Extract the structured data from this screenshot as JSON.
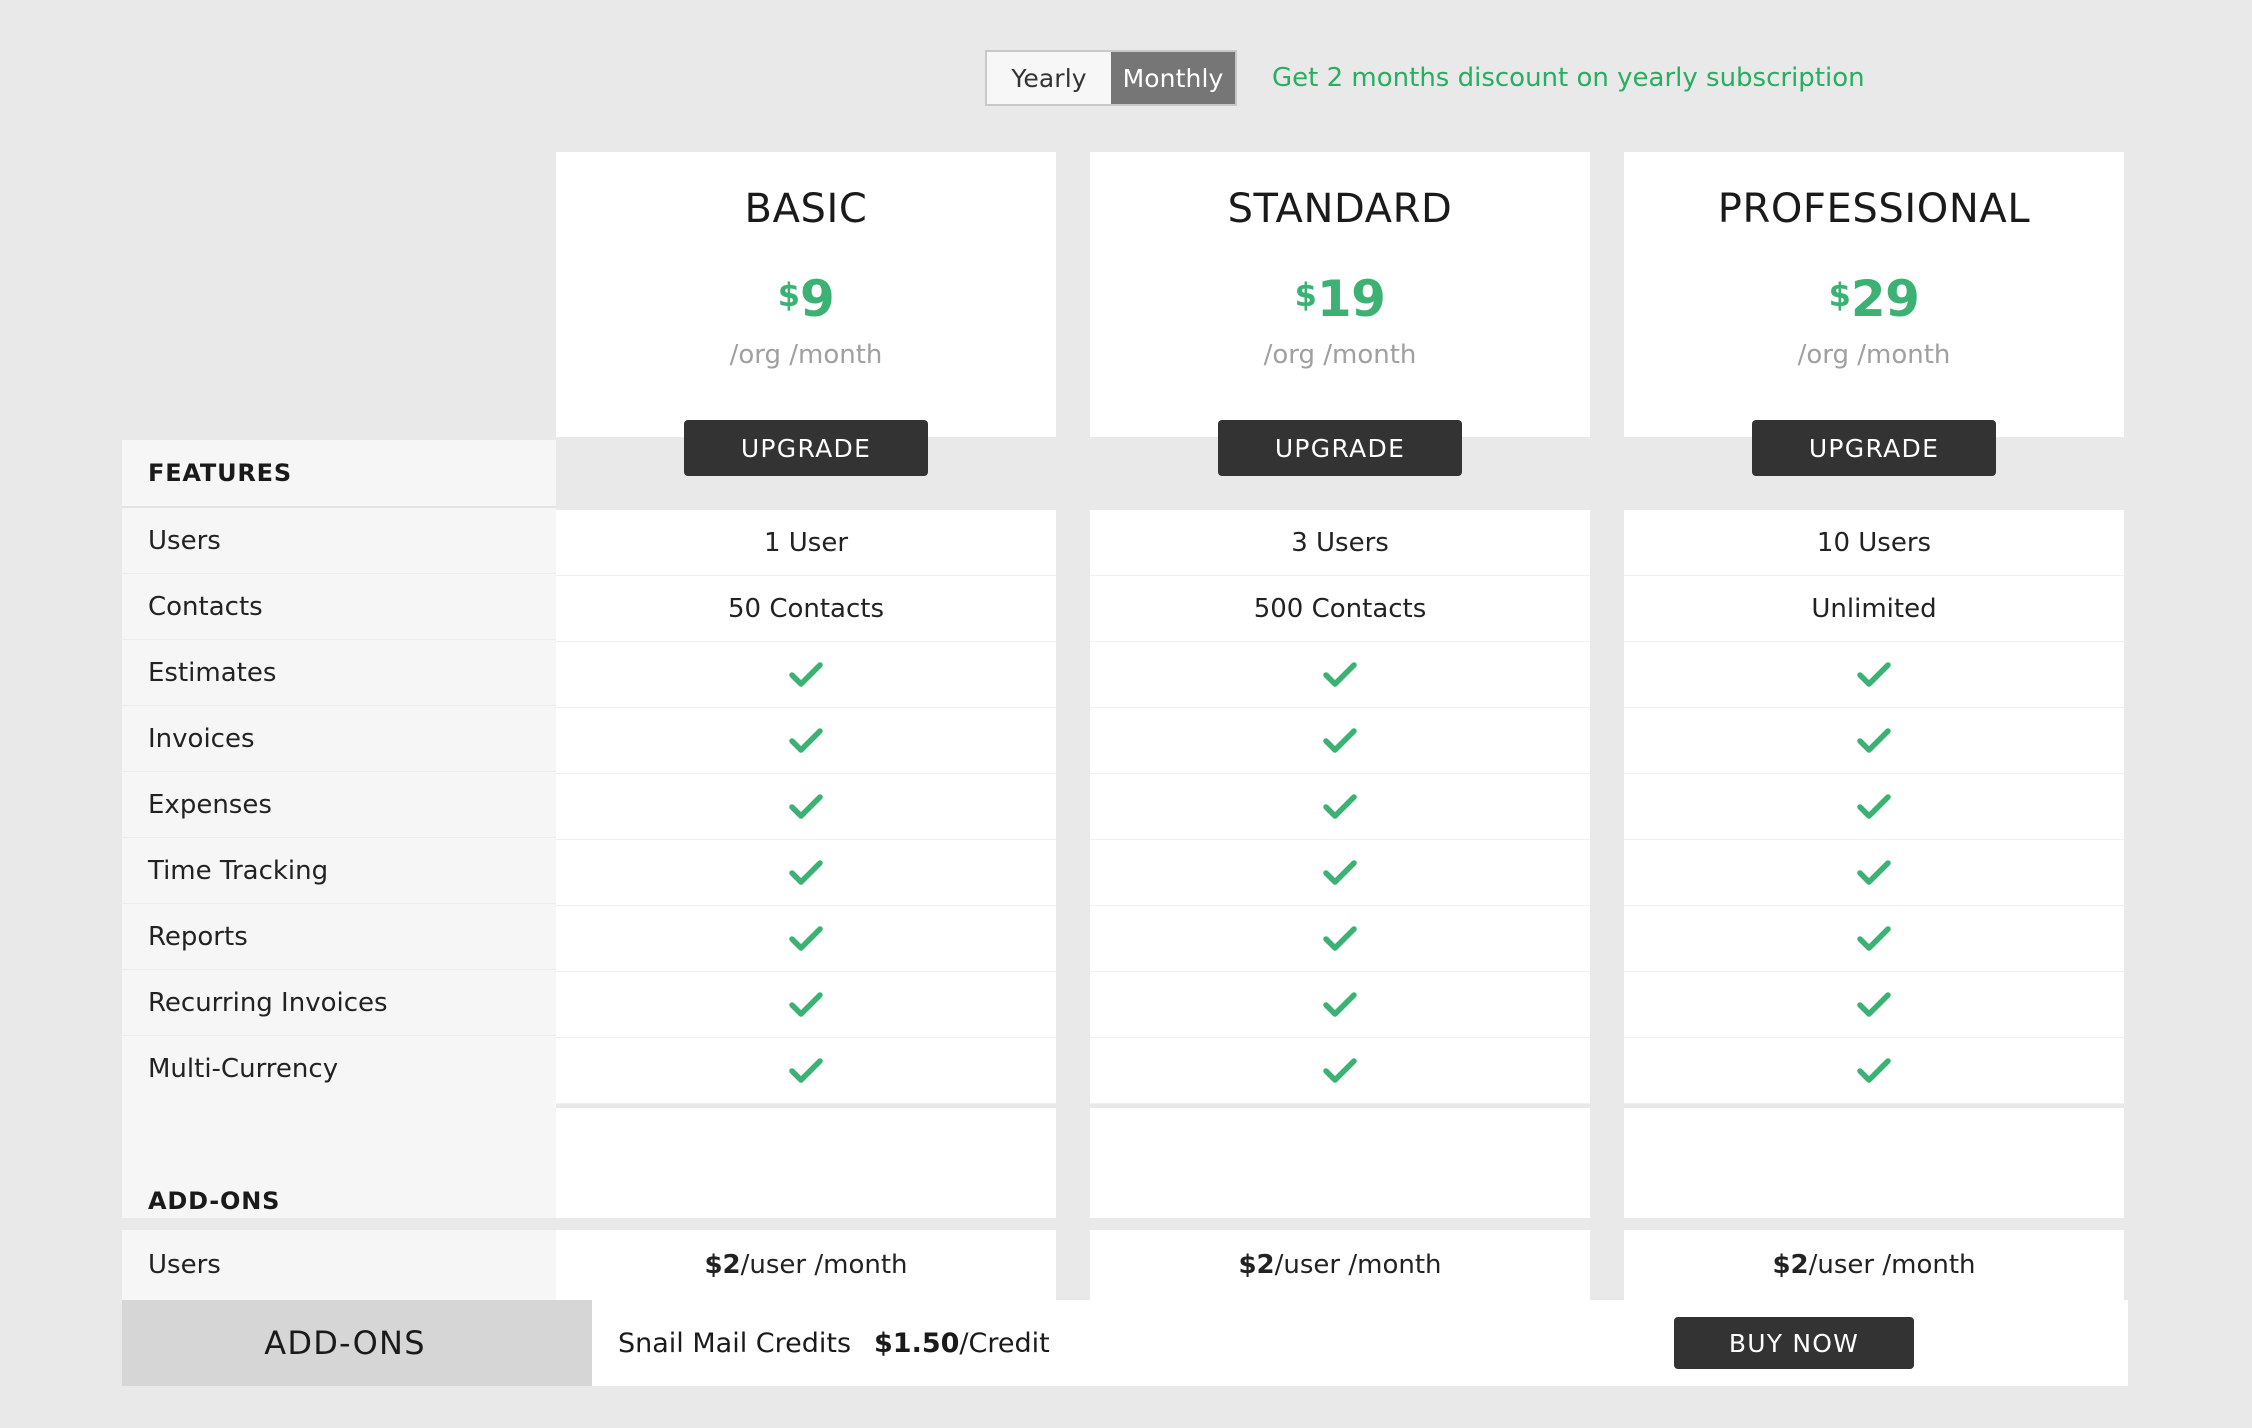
{
  "billing": {
    "options": [
      {
        "label": "Yearly",
        "active": false
      },
      {
        "label": "Monthly",
        "active": true
      }
    ],
    "discount_note": "Get 2 months discount on yearly subscription"
  },
  "colors": {
    "page_background": "#e9e9e9",
    "accent_green": "#3bb273",
    "note_green": "#27ae60",
    "button_dark": "#333333",
    "sidebar_background": "#f6f6f6",
    "addons_label_background": "#d6d6d6",
    "toggle_active_background": "#767676"
  },
  "plans": [
    {
      "name": "BASIC",
      "currency": "$",
      "amount": "9",
      "period": "/org /month",
      "cta": "UPGRADE",
      "addon_user_price_amount": "$2",
      "addon_user_price_unit": " /user /month"
    },
    {
      "name": "STANDARD",
      "currency": "$",
      "amount": "19",
      "period": "/org /month",
      "cta": "UPGRADE",
      "addon_user_price_amount": "$2",
      "addon_user_price_unit": " /user /month"
    },
    {
      "name": "PROFESSIONAL",
      "currency": "$",
      "amount": "29",
      "period": "/org /month",
      "cta": "UPGRADE",
      "addon_user_price_amount": "$2",
      "addon_user_price_unit": " /user /month"
    }
  ],
  "features_section": {
    "title": "FEATURES",
    "rows": [
      {
        "label": "Users",
        "values": [
          "1 User",
          "3 Users",
          "10 Users"
        ]
      },
      {
        "label": "Contacts",
        "values": [
          "50 Contacts",
          "500 Contacts",
          "Unlimited"
        ]
      },
      {
        "label": "Estimates",
        "values": [
          "check",
          "check",
          "check"
        ]
      },
      {
        "label": "Invoices",
        "values": [
          "check",
          "check",
          "check"
        ]
      },
      {
        "label": "Expenses",
        "values": [
          "check",
          "check",
          "check"
        ]
      },
      {
        "label": "Time Tracking",
        "values": [
          "check",
          "check",
          "check"
        ]
      },
      {
        "label": "Reports",
        "values": [
          "check",
          "check",
          "check"
        ]
      },
      {
        "label": "Recurring Invoices",
        "values": [
          "check",
          "check",
          "check"
        ]
      },
      {
        "label": "Multi-Currency",
        "values": [
          "check",
          "check",
          "check"
        ]
      }
    ]
  },
  "addons_section": {
    "title": "ADD-ONS",
    "rows": [
      {
        "label": "Users"
      }
    ]
  },
  "addons_bar": {
    "label": "ADD-ONS",
    "item": "Snail Mail Credits",
    "price_amount": "$1.50",
    "price_unit": " /Credit",
    "cta": "BUY NOW"
  }
}
